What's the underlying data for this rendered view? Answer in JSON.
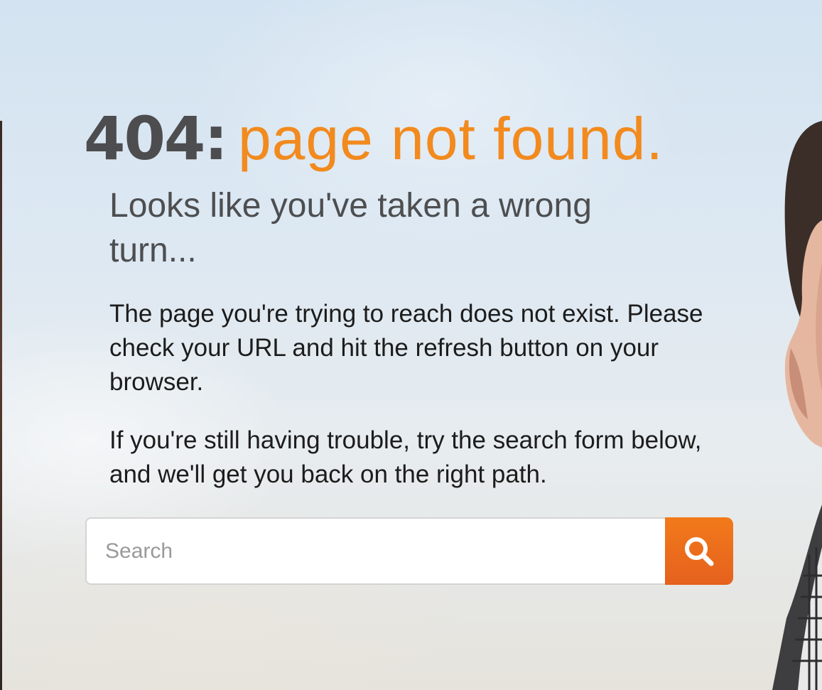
{
  "error": {
    "code": "404:",
    "message": "page not found."
  },
  "subheading": "Looks like you've taken a wrong turn...",
  "paragraphs": [
    "The page you're trying to reach does not exist. Please check your URL and hit the refresh button on your browser.",
    "If you're still having trouble, try the search form below, and we'll get you back on the right path."
  ],
  "search": {
    "placeholder": "Search",
    "value": "",
    "button_icon": "search-icon"
  },
  "colors": {
    "accent": "#f28a1e",
    "button": "#ee6f1c",
    "heading_dark": "#4d4d4f",
    "body_text": "#1c1c1c"
  }
}
